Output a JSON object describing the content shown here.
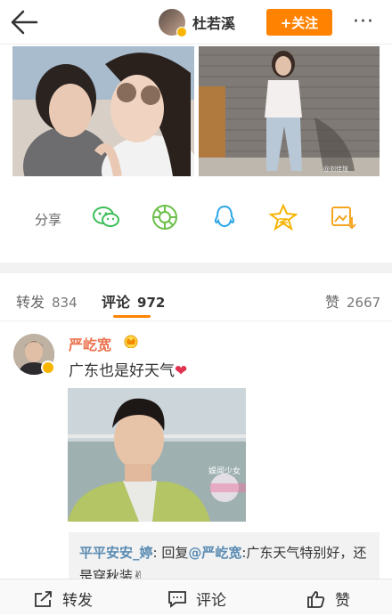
{
  "header": {
    "title": "杜若溪",
    "follow_label": "+关注",
    "more_label": "···"
  },
  "photos": {
    "watermark": "@刘佳瑄"
  },
  "share": {
    "label": "分享",
    "targets": [
      "wechat-icon",
      "moments-icon",
      "qq-icon",
      "qzone-icon",
      "save-image-icon"
    ]
  },
  "tabs": [
    {
      "label": "转发",
      "count": "834"
    },
    {
      "label": "评论",
      "count": "972"
    },
    {
      "label": "赞",
      "count": "2667"
    }
  ],
  "comment": {
    "author": "严屹宽",
    "text": "广东也是好天气",
    "emoji": "❤",
    "image_watermark": "娱闻少女",
    "reply": {
      "user": "平平安安_婷",
      "prefix": ": 回复",
      "mention": "@严屹宽",
      "text": ":广东天气特别好，还是穿秋装✌"
    }
  },
  "bottom": {
    "repost": "转发",
    "comment": "评论",
    "like": "赞"
  },
  "colors": {
    "accent": "#ff8200",
    "username": "#eb7350",
    "link": "#5b8cb3"
  }
}
